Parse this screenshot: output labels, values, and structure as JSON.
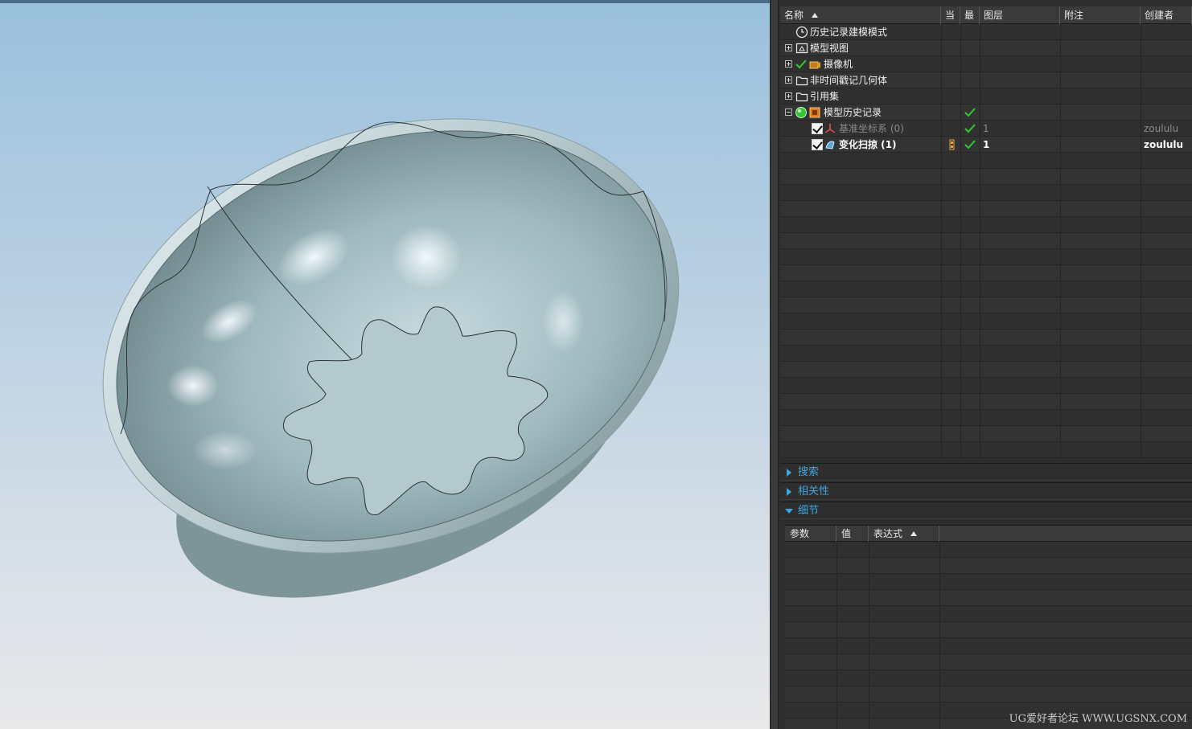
{
  "tree": {
    "columns": [
      "名称",
      "当",
      "最",
      "图层",
      "附注",
      "创建者"
    ],
    "rows": [
      {
        "label": "历史记录建模模式",
        "icon": "clock-icon",
        "expander": "none",
        "indent": 0
      },
      {
        "label": "模型视图",
        "icon": "model-view-icon",
        "expander": "plus",
        "indent": 0
      },
      {
        "label": "摄像机",
        "icon": "camera-icon",
        "expander": "plus",
        "indent": 0,
        "check": true
      },
      {
        "label": "非时间戳记几何体",
        "icon": "folder-icon",
        "expander": "plus",
        "indent": 0
      },
      {
        "label": "引用集",
        "icon": "folder-icon",
        "expander": "plus",
        "indent": 0
      },
      {
        "label": "模型历史记录",
        "icon": "history-icon",
        "expander": "minus",
        "indent": 0,
        "latest": true
      },
      {
        "label": "基准坐标系 (0)",
        "icon": "datum-csys-icon",
        "indent": 1,
        "checkbox": true,
        "latest": true,
        "layer": "1",
        "creator": "zoululu",
        "dim": true
      },
      {
        "label": "变化扫掠 (1)",
        "icon": "variational-sweep-icon",
        "indent": 1,
        "checkbox": true,
        "latest": true,
        "layer": "1",
        "creator": "zoululu",
        "bold": true,
        "current": true
      }
    ]
  },
  "sections": {
    "search": "搜索",
    "dependencies": "相关性",
    "details": "细节"
  },
  "details": {
    "columns": [
      "参数",
      "值",
      "表达式"
    ]
  },
  "watermark": "UG爱好者论坛 WWW.UGSNX.COM",
  "colors": {
    "accent": "#3aa6e0",
    "check_green": "#2ec92e",
    "viewport_top": "#9ac0dd",
    "viewport_bottom": "#e9e9ea",
    "panel_bg": "#2d2d2d"
  }
}
